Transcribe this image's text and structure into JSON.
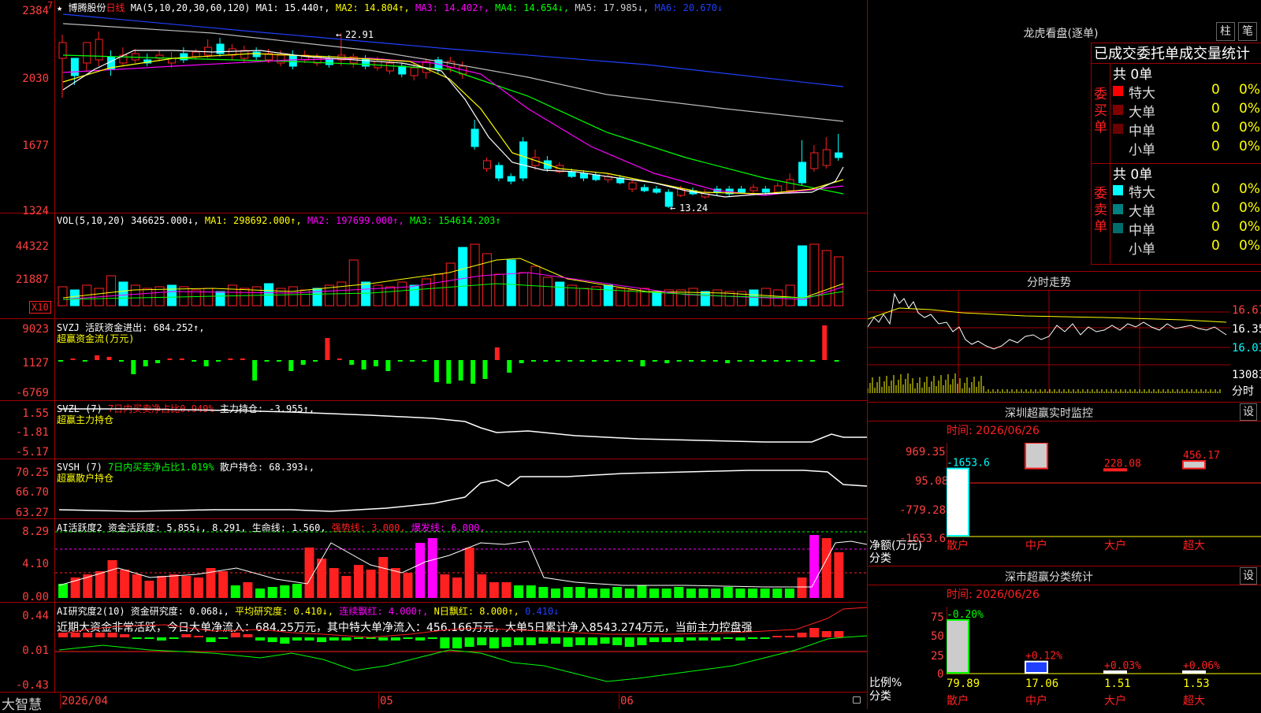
{
  "header": {
    "star": "★",
    "stock_name": "博腾股份",
    "period": "日线",
    "ma_def": "MA(5,10,20,30,60,120)",
    "ma1": "MA1: 15.440↑,",
    "ma2": "MA2: 14.804↑,",
    "ma3": "MA3: 14.402↑,",
    "ma4": "MA4: 14.654↓,",
    "ma5": "MA5: 17.985↓,",
    "ma6": "MA6: 20.670↓",
    "top_marker": "7"
  },
  "price_axis": [
    "2384",
    "2030",
    "1677",
    "1324"
  ],
  "price_annotations": {
    "high": "22.91",
    "low": "13.24"
  },
  "vol": {
    "def": "VOL(5,10,20)",
    "value": "346625.000↓,",
    "ma1": "MA1: 298692.000↑,",
    "ma2": "MA2: 197699.000↑,",
    "ma3": "MA3: 154614.203↑",
    "axis": [
      "44322",
      "21887"
    ],
    "unit": "X10"
  },
  "svzj": {
    "line1": "SVZJ  活跃资金进出: 684.252↑,",
    "line2": "超赢资金流(万元)",
    "axis": [
      "9023",
      "1127",
      "-6769"
    ]
  },
  "svzl": {
    "def": "SVZL (7)",
    "mid": "7日内买卖净占比0.949%",
    "end": "主力持仓: -3.955↑,",
    "line2": "超赢主力持仓",
    "axis": [
      "1.55",
      "-1.81",
      "-5.17"
    ]
  },
  "svsh": {
    "def": "SVSH (7)",
    "mid": "7日内买卖净占比1.019%",
    "end": "散户持仓: 68.393↓,",
    "line2": "超赢散户持仓",
    "axis": [
      "70.25",
      "66.70",
      "63.27"
    ]
  },
  "ai_active": {
    "a": "AI活跃度2 资金活跃度: 5.855↓,",
    "b": "8.291,",
    "c": "生命线: 1.560,",
    "d": "强势线: 3.000,",
    "e": "爆发线: 6.000,",
    "axis": [
      "8.29",
      "4.10",
      "0.00"
    ]
  },
  "ai_research": {
    "a": "AI研究度2(10) 资金研究度: 0.068↓,",
    "b": "平均研究度: 0.410↓,",
    "c": "连续飘红: 4.000↑,",
    "d": "N日飘红: 8.000↑,",
    "e": "0.410↓",
    "note": "近期大资金非常活跃，今日大单净流入：684.25万元，其中特大单净流入：456.166万元，大单5日累计净入8543.274万元，当前主力控盘强",
    "axis": [
      "0.44",
      "0.01",
      "-0.43"
    ]
  },
  "footer": {
    "brand": "大智慧",
    "dates": [
      "2026/04",
      "05",
      "06"
    ]
  },
  "right": {
    "lhb_title": "龙虎看盘(逐单)",
    "btn_bar": "柱",
    "btn_pen": "笔",
    "stats_title": "已成交委托单成交量统计",
    "buy_label": [
      "委",
      "买",
      "单"
    ],
    "sell_label": [
      "委",
      "卖",
      "单"
    ],
    "buy_total": "共 0单",
    "sell_total": "共 0单",
    "buy_rows": [
      {
        "name": "特大",
        "count": "0",
        "pct": "0%",
        "color": "#ff0000"
      },
      {
        "name": "大单",
        "count": "0",
        "pct": "0%",
        "color": "#800000"
      },
      {
        "name": "中单",
        "count": "0",
        "pct": "0%",
        "color": "#6a0000"
      },
      {
        "name": "小单",
        "count": "0",
        "pct": "0%",
        "color": "#000000"
      }
    ],
    "sell_rows": [
      {
        "name": "特大",
        "count": "0",
        "pct": "0%",
        "color": "#00ffff"
      },
      {
        "name": "大单",
        "count": "0",
        "pct": "0%",
        "color": "#008080"
      },
      {
        "name": "中单",
        "count": "0",
        "pct": "0%",
        "color": "#006c6c"
      },
      {
        "name": "小单",
        "count": "0",
        "pct": "0%",
        "color": "#000000"
      }
    ],
    "intraday_title": "分时走势",
    "intraday_axis": [
      "16.67",
      "16.35",
      "16.03",
      "13083",
      "分时"
    ],
    "monitor_title": "深圳超赢实时监控",
    "monitor_btn": "设",
    "monitor_time": "时间: 2026/06/26",
    "monitor_axis": [
      "969.35",
      "95.08",
      "-779.28",
      "-1653.6"
    ],
    "monitor_unit": "净额(万元)",
    "monitor_class": "分类",
    "monitor_bars": [
      {
        "cat": "散户",
        "label": "-1653.6",
        "value": -1653.6
      },
      {
        "cat": "中户",
        "label": "969.35",
        "value": 969.35
      },
      {
        "cat": "大户",
        "label": "228.08",
        "value": 228.08
      },
      {
        "cat": "超大",
        "label": "456.17",
        "value": 456.17
      }
    ],
    "class_title": "深市超赢分类统计",
    "class_btn": "设",
    "class_time": "时间: 2026/06/26",
    "class_axis": [
      "75",
      "50",
      "25",
      "0"
    ],
    "class_unit": "比例%",
    "class_class": "分类",
    "class_bars": [
      {
        "cat": "散户",
        "top": "-0.20%",
        "val": "79.89",
        "value": 79.89
      },
      {
        "cat": "中户",
        "top": "+0.12%",
        "val": "17.06",
        "value": 17.06
      },
      {
        "cat": "大户",
        "top": "+0.03%",
        "val": "1.51",
        "value": 1.51
      },
      {
        "cat": "超大",
        "top": "+0.06%",
        "val": "1.53",
        "value": 1.53
      }
    ]
  },
  "colors": {
    "up": "#ff2020",
    "down": "#00ffff",
    "grid": "#a00000",
    "green": "#00ff00",
    "magenta": "#ff00ff",
    "yellow": "#ffff00"
  }
}
